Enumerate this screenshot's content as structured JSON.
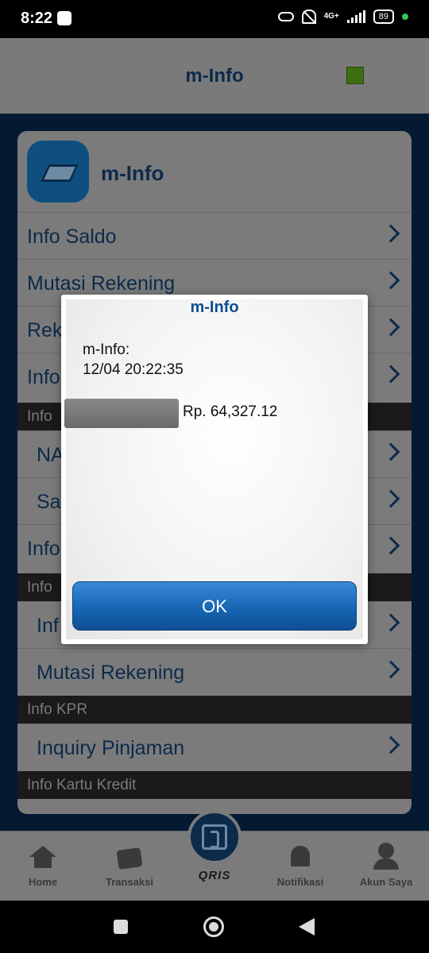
{
  "status_bar": {
    "time": "8:22",
    "network": "4G+",
    "battery": "89"
  },
  "header": {
    "title": "m-Info"
  },
  "card": {
    "title": "m-Info",
    "items": [
      {
        "label": "Info Saldo"
      },
      {
        "label": "Mutasi Rekening"
      },
      {
        "label": "Rek"
      },
      {
        "label": "Info"
      }
    ],
    "section1": "Info",
    "section1_items": [
      {
        "label": "NA"
      },
      {
        "label": "Sa"
      },
      {
        "label": "Info"
      }
    ],
    "section2": "Info",
    "section2_items": [
      {
        "label": "Inf"
      },
      {
        "label": "Mutasi Rekening"
      }
    ],
    "section3": "Info KPR",
    "section3_items": [
      {
        "label": "Inquiry Pinjaman"
      }
    ],
    "section4": "Info Kartu Kredit"
  },
  "bottom_nav": {
    "home": "Home",
    "transaksi": "Transaksi",
    "qris": "QRIS",
    "notifikasi": "Notifikasi",
    "akun": "Akun Saya"
  },
  "dialog": {
    "title": "m-Info",
    "line1": "m-Info:",
    "line2": "12/04 20:22:35",
    "amount": "Rp. 64,327.12",
    "ok_label": "OK"
  }
}
